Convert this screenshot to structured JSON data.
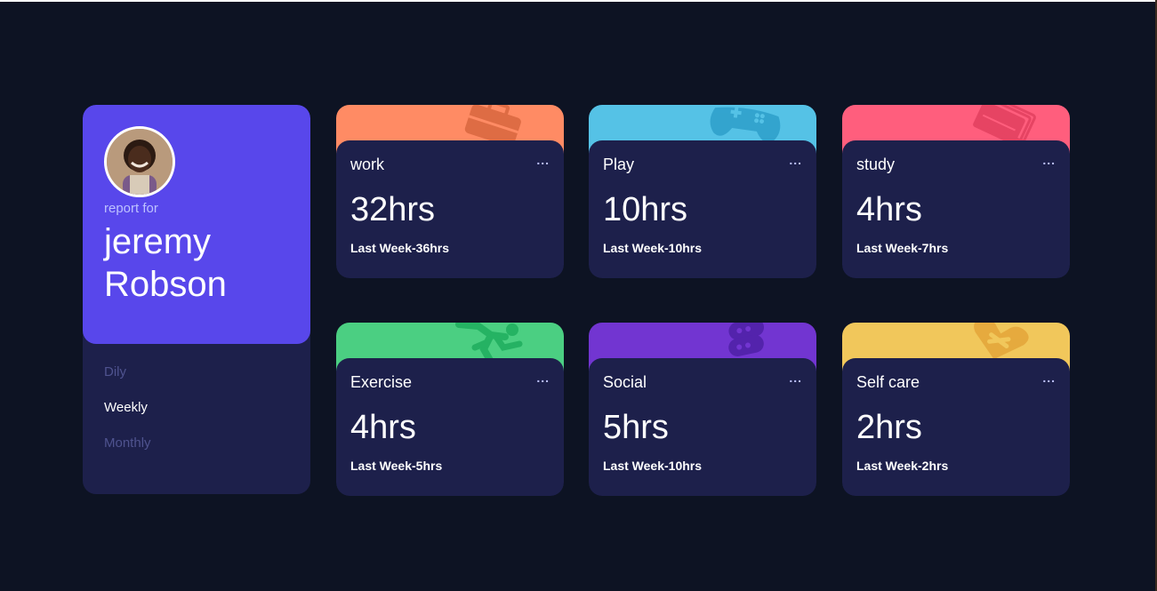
{
  "profile": {
    "report_for": "report for",
    "name": "jeremy Robson",
    "periods": [
      {
        "label": "Dily",
        "active": false
      },
      {
        "label": "Weekly",
        "active": true
      },
      {
        "label": "Monthly",
        "active": false
      }
    ]
  },
  "activities": [
    {
      "title": "work",
      "current": "32hrs",
      "previous": "Last Week-36hrs",
      "color": "#ff8b64",
      "icon": "briefcase-icon",
      "icon_color": "#d9673f"
    },
    {
      "title": "Play",
      "current": "10hrs",
      "previous": "Last Week-10hrs",
      "color": "#55c2e6",
      "icon": "gamepad-icon",
      "icon_color": "#2e9fca"
    },
    {
      "title": "study",
      "current": "4hrs",
      "previous": "Last Week-7hrs",
      "color": "#ff5e7d",
      "icon": "book-icon",
      "icon_color": "#e2405f"
    },
    {
      "title": "Exercise",
      "current": "4hrs",
      "previous": "Last Week-5hrs",
      "color": "#4bcf82",
      "icon": "running-icon",
      "icon_color": "#1fae5e"
    },
    {
      "title": "Social",
      "current": "5hrs",
      "previous": "Last Week-10hrs",
      "color": "#7235d1",
      "icon": "chat-bubbles-icon",
      "icon_color": "#4e20a6"
    },
    {
      "title": "Self care",
      "current": "2hrs",
      "previous": "Last Week-2hrs",
      "color": "#f1c75b",
      "icon": "heart-bandage-icon",
      "icon_color": "#e4a53a"
    }
  ],
  "card_menu": "..."
}
